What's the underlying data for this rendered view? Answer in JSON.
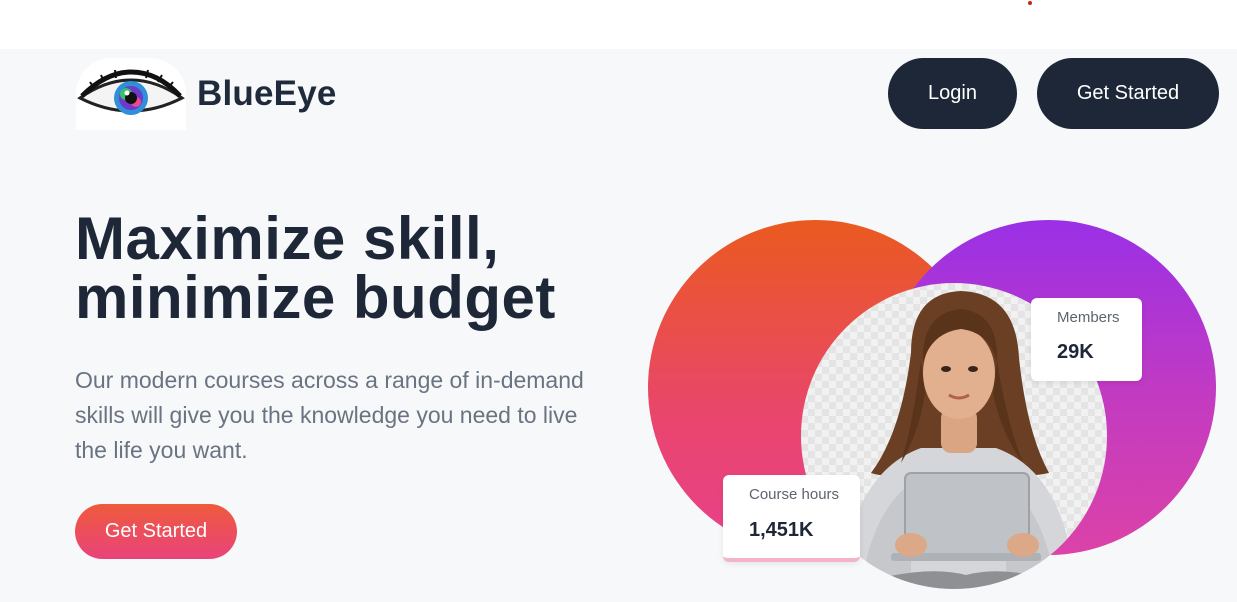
{
  "brand": {
    "name": "BlueEye",
    "logo_icon": "eye-icon"
  },
  "nav": {
    "login_label": "Login",
    "get_started_label": "Get Started"
  },
  "hero": {
    "title_line1": "Maximize skill,",
    "title_line2": "minimize budget",
    "description": "Our modern courses across a range of in-demand skills will give you the knowledge you need to live the life you want.",
    "cta_label": "Get Started"
  },
  "stats": {
    "members": {
      "label": "Members",
      "value": "29K"
    },
    "course_hours": {
      "label": "Course hours",
      "value": "1,451K"
    }
  },
  "colors": {
    "dark": "#1e2737",
    "cta_start": "#ef5a3c",
    "cta_end": "#e9437b",
    "circle_left_top": "#ea5a1f",
    "circle_right_top": "#9a30e6",
    "page_bg": "#f7f8fa"
  }
}
